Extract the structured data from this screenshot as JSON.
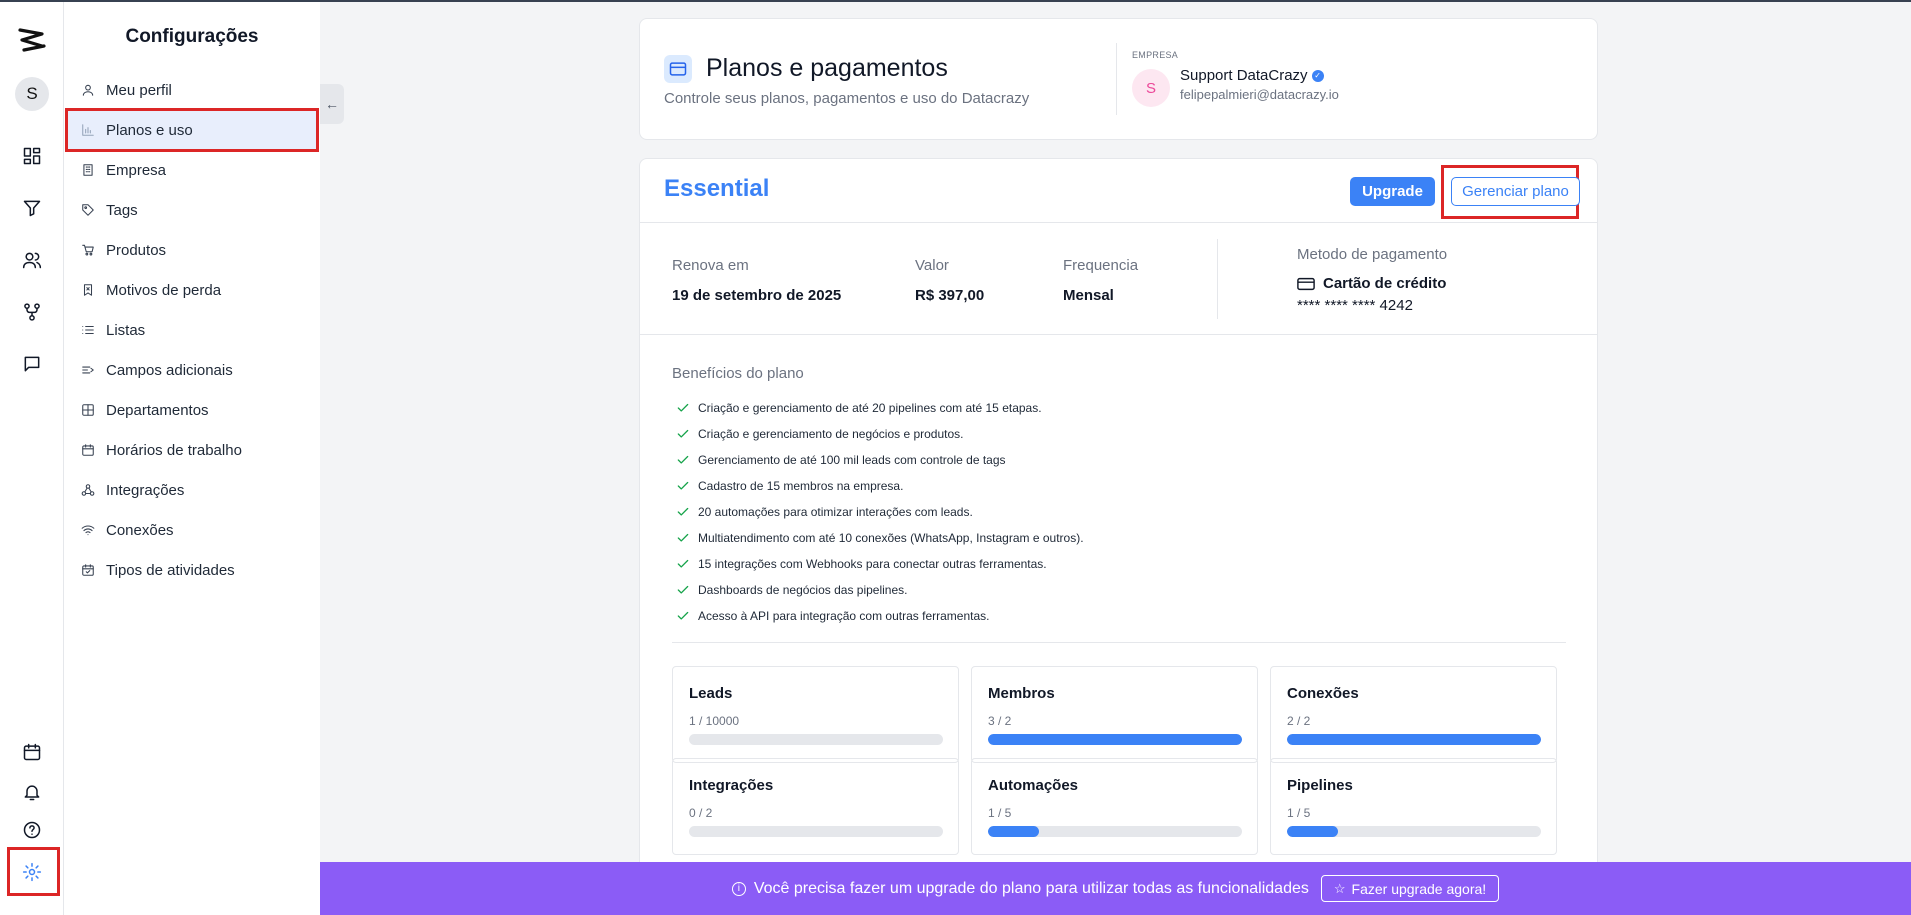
{
  "rail": {
    "avatar_initial": "S",
    "top_icons": [
      "dashboard-icon",
      "filter-icon",
      "users-icon",
      "flow-icon",
      "chat-icon"
    ],
    "bottom_icons": [
      "calendar-icon",
      "bell-icon",
      "help-icon",
      "gear-icon"
    ]
  },
  "sidebar": {
    "title": "Configurações",
    "items": [
      {
        "label": "Meu perfil",
        "icon": "user-icon"
      },
      {
        "label": "Planos e uso",
        "icon": "chart-icon",
        "active": true
      },
      {
        "label": "Empresa",
        "icon": "building-icon"
      },
      {
        "label": "Tags",
        "icon": "tag-icon"
      },
      {
        "label": "Produtos",
        "icon": "cart-icon"
      },
      {
        "label": "Motivos de perda",
        "icon": "bookmark-x-icon"
      },
      {
        "label": "Listas",
        "icon": "list-icon"
      },
      {
        "label": "Campos adicionais",
        "icon": "text-cursor-icon"
      },
      {
        "label": "Departamentos",
        "icon": "grid-icon"
      },
      {
        "label": "Horários de trabalho",
        "icon": "calendar-icon"
      },
      {
        "label": "Integrações",
        "icon": "webhook-icon"
      },
      {
        "label": "Conexões",
        "icon": "wifi-icon"
      },
      {
        "label": "Tipos de atividades",
        "icon": "calendar-check-icon"
      }
    ]
  },
  "header": {
    "title": "Planos e pagamentos",
    "subtitle": "Controle seus planos, pagamentos e uso do Datacrazy",
    "company_label": "EMPRESA",
    "company_initial": "S",
    "company_name": "Support DataCrazy",
    "company_email": "felipepalmieri@datacrazy.io"
  },
  "plan": {
    "name": "Essential",
    "upgrade_label": "Upgrade",
    "manage_label": "Gerenciar plano",
    "renew_label": "Renova em",
    "renew_value": "19 de setembro de 2025",
    "price_label": "Valor",
    "price_value": "R$ 397,00",
    "frequency_label": "Frequencia",
    "frequency_value": "Mensal",
    "payment_label": "Metodo de pagamento",
    "payment_type": "Cartão de crédito",
    "payment_number": "**** **** **** 4242",
    "benefits_title": "Benefícios do plano",
    "benefits": [
      "Criação e gerenciamento de até 20 pipelines com até 15 etapas.",
      "Criação e gerenciamento de negócios e produtos.",
      "Gerenciamento de até 100 mil leads com controle de tags",
      "Cadastro de 15 membros na empresa.",
      "20 automações para otimizar interações com leads.",
      "Multiatendimento com até 10 conexões (WhatsApp, Instagram e outros).",
      "15 integrações com Webhooks para conectar outras ferramentas.",
      "Dashboards de negócios das pipelines.",
      "Acesso à API para integração com outras ferramentas."
    ],
    "usage": [
      {
        "title": "Leads",
        "count": "1 / 10000",
        "fill": 0.0001
      },
      {
        "title": "Membros",
        "count": "3 / 2",
        "fill": 1
      },
      {
        "title": "Conexões",
        "count": "2 / 2",
        "fill": 1
      },
      {
        "title": "Integrações",
        "count": "0 / 2",
        "fill": 0
      },
      {
        "title": "Automações",
        "count": "1 / 5",
        "fill": 0.2
      },
      {
        "title": "Pipelines",
        "count": "1 / 5",
        "fill": 0.2
      }
    ]
  },
  "banner": {
    "message": "Você precisa fazer um upgrade do plano para utilizar todas as funcionalidades",
    "button_label": "Fazer upgrade agora!"
  },
  "colors": {
    "accent": "#3b82f6",
    "banner": "#8b5cf6",
    "highlight": "#dc2626",
    "check": "#16a34a"
  }
}
